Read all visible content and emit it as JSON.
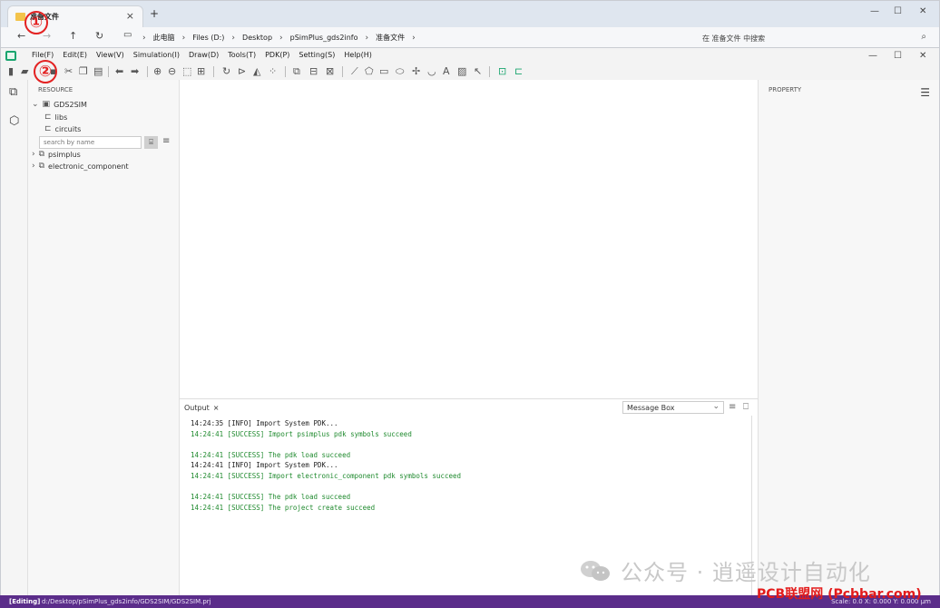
{
  "explorer": {
    "tab_title": "准备文件",
    "crumbs": [
      "此电脑",
      "Files (D:)",
      "Desktop",
      "pSimPlus_gds2info",
      "准备文件"
    ],
    "search_placeholder": "在 准备文件 中搜索"
  },
  "app": {
    "menus": [
      "File(F)",
      "Edit(E)",
      "View(V)",
      "Simulation(I)",
      "Draw(D)",
      "Tools(T)",
      "PDK(P)",
      "Setting(S)",
      "Help(H)"
    ]
  },
  "resource": {
    "title": "RESOURCE",
    "project": "GDS2SIM",
    "folders": [
      "libs",
      "circuits"
    ],
    "search_placeholder": "search by name",
    "libraries": [
      "psimplus",
      "electronic_component"
    ]
  },
  "property": {
    "title": "PROPERTY"
  },
  "output": {
    "tab_label": "Output",
    "filter_value": "Message Box",
    "lines": [
      {
        "text": "14:24:35 [INFO] Import System PDK...",
        "level": "info"
      },
      {
        "text": "14:24:41 [SUCCESS] Import psimplus pdk symbols succeed",
        "level": "ok"
      },
      {
        "text": "",
        "level": "info"
      },
      {
        "text": "14:24:41 [SUCCESS] The pdk load succeed",
        "level": "ok"
      },
      {
        "text": "14:24:41 [INFO] Import System PDK...",
        "level": "info"
      },
      {
        "text": "14:24:41 [SUCCESS] Import electronic_component pdk symbols succeed",
        "level": "ok"
      },
      {
        "text": "",
        "level": "info"
      },
      {
        "text": "14:24:41 [SUCCESS] The pdk load succeed",
        "level": "ok"
      },
      {
        "text": "14:24:41 [SUCCESS] The project create succeed",
        "level": "ok"
      }
    ]
  },
  "status": {
    "mode": "[Editing]",
    "path": "d:/Desktop/pSimPlus_gds2info/GDS2SIM/GDS2SIM.prj",
    "right": "Scale: 0.0   X: 0.000 Y: 0.000  μm"
  },
  "annotations": {
    "marker1": "①",
    "marker2": "②"
  },
  "watermark": {
    "text": "公众号 · 逍遥设计自动化",
    "site": "PCB联盟网 (Pcbbar.com)"
  },
  "colors": {
    "status_bar": "#5b2d8a",
    "success": "#1f8a2e",
    "marker": "#e32222"
  }
}
